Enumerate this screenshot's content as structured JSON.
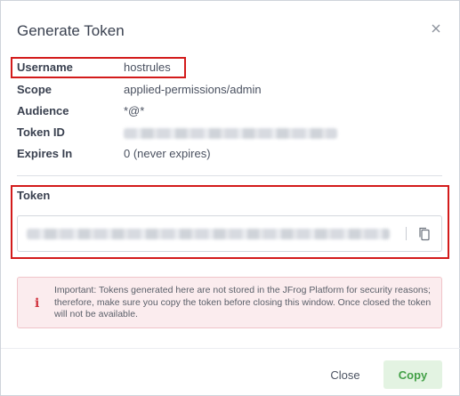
{
  "dialog": {
    "title": "Generate Token",
    "close_icon": "close-icon"
  },
  "info": {
    "username": {
      "label": "Username",
      "value": "hostrules"
    },
    "scope": {
      "label": "Scope",
      "value": "applied-permissions/admin"
    },
    "audience": {
      "label": "Audience",
      "value": "*@*"
    },
    "token_id": {
      "label": "Token ID",
      "value": ""
    },
    "expires_in": {
      "label": "Expires In",
      "value": "0 (never expires)"
    }
  },
  "token": {
    "label": "Token",
    "copy_icon": "copy-icon"
  },
  "warning": {
    "icon": "i",
    "text": "Important: Tokens generated here are not stored in the JFrog Platform for security reasons; therefore, make sure you copy the token before closing this window. Once closed the token will not be available."
  },
  "footer": {
    "close_label": "Close",
    "copy_label": "Copy"
  },
  "colors": {
    "highlight": "#d31b1b",
    "copy_button_bg": "#e3f3e2",
    "copy_button_text": "#43a047",
    "warning_bg": "#fbecee"
  }
}
